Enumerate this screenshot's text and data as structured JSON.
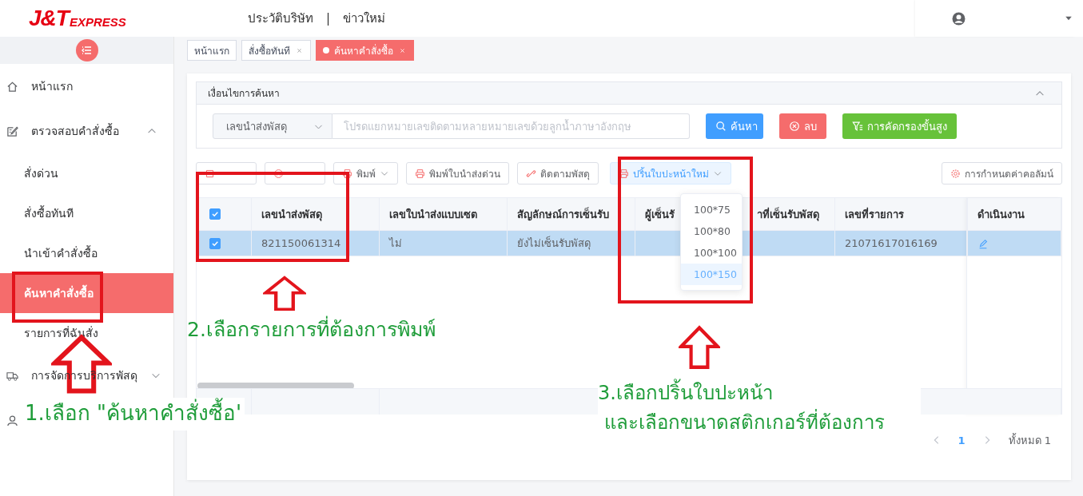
{
  "header": {
    "logo": {
      "main": "J&T",
      "sub": "EXPRESS"
    },
    "nav_links": [
      "ประวัติบริษัท",
      "ข่าวใหม่"
    ],
    "separator": "|"
  },
  "sidebar": {
    "items": [
      {
        "label": "หน้าแรก",
        "kind": "home"
      },
      {
        "label": "ตรวจสอบคำสั่งซื้อ",
        "kind": "edit",
        "expanded": true,
        "children": [
          {
            "label": "สั่งด่วน",
            "selected": false
          },
          {
            "label": "สั่งซื้อทันที",
            "selected": false
          },
          {
            "label": "นำเข้าคำสั่งซื้อ",
            "selected": false
          },
          {
            "label": "ค้นหาคำสั่งซื้อ",
            "selected": true
          },
          {
            "label": "รายการที่ฉันสั่ง",
            "selected": false
          }
        ]
      },
      {
        "label": "การจัดการบริการพัสดุ",
        "kind": "truck",
        "expanded": false
      },
      {
        "kind": "user"
      }
    ]
  },
  "tabs": [
    {
      "label": "หน้าแรก",
      "closable": false,
      "selected": false
    },
    {
      "label": "สั่งซื้อทันที",
      "closable": true,
      "selected": false
    },
    {
      "label": "ค้นหาคำสั่งซื้อ",
      "closable": true,
      "selected": true
    }
  ],
  "search_panel": {
    "title": "เงื่อนไขการค้นหา",
    "expanded": true,
    "field_select": "เลขนำส่งพัสดุ",
    "placeholder": "โปรดแยกหมายเลขติดตามหลายหมายเลขด้วยลูกน้ำภาษาอังกฤษ",
    "buttons": [
      {
        "label": "ค้นหา",
        "kind": "search"
      },
      {
        "label": "ลบ",
        "kind": "clear"
      },
      {
        "label": "การคัดกรองขั้นสูง",
        "kind": "filter"
      }
    ]
  },
  "toolbar": {
    "buttons": [
      {
        "kind": "export",
        "dropdown": false,
        "open": false
      },
      {
        "kind": "cancel",
        "dropdown": false,
        "open": false
      },
      {
        "label": "พิมพ์",
        "kind": "print",
        "dropdown": true,
        "open": false
      },
      {
        "label": "พิมพ์ใบนำส่งด่วน",
        "kind": "print",
        "dropdown": false,
        "open": false
      },
      {
        "label": "ติดตามพัสดุ",
        "kind": "track",
        "dropdown": false,
        "open": false
      },
      {
        "label": "ปริ้นใบปะหน้าใหม่",
        "kind": "print",
        "dropdown": true,
        "open": true
      }
    ],
    "column_settings": "การกำหนดค่าคอลัมน์"
  },
  "dropdown_menu": {
    "items": [
      {
        "label": "100*75",
        "selected": false
      },
      {
        "label": "100*80",
        "selected": false
      },
      {
        "label": "100*100",
        "selected": false
      },
      {
        "label": "100*150",
        "selected": true
      }
    ]
  },
  "table": {
    "all_checked": true,
    "columns": [
      "เลขนำส่งพัสดุ",
      "เลขใบนำส่งแบบเซต",
      "สัญลักษณ์การเซ็นรับ",
      "ผู้เซ็นรั",
      "าที่เซ็นรับพัสดุ",
      "เลขที่รายการ",
      "ดำเนินงาน"
    ],
    "rows": [
      {
        "checked": true,
        "selected": true,
        "tracking_no": "821150061314",
        "set_waybill": "ไม่",
        "sign_status": "ยังไม่เซ็นรับพัสดุ",
        "order_no": "21071617016169"
      }
    ]
  },
  "pagination": {
    "pages": [
      {
        "label": "1",
        "selected": true
      }
    ],
    "total": "ทั้งหมด 1"
  },
  "annotations": {
    "step_1": "1.เลือก \"ค้นหาคำสั่งซื้อ'",
    "step_2": "2.เลือกรายการที่ต้องการพิมพ์",
    "step_3": [
      "3.เลือกปริ้นใบปะหน้า",
      "และเลือกขนาดสติกเกอร์ที่ต้องการ"
    ]
  }
}
